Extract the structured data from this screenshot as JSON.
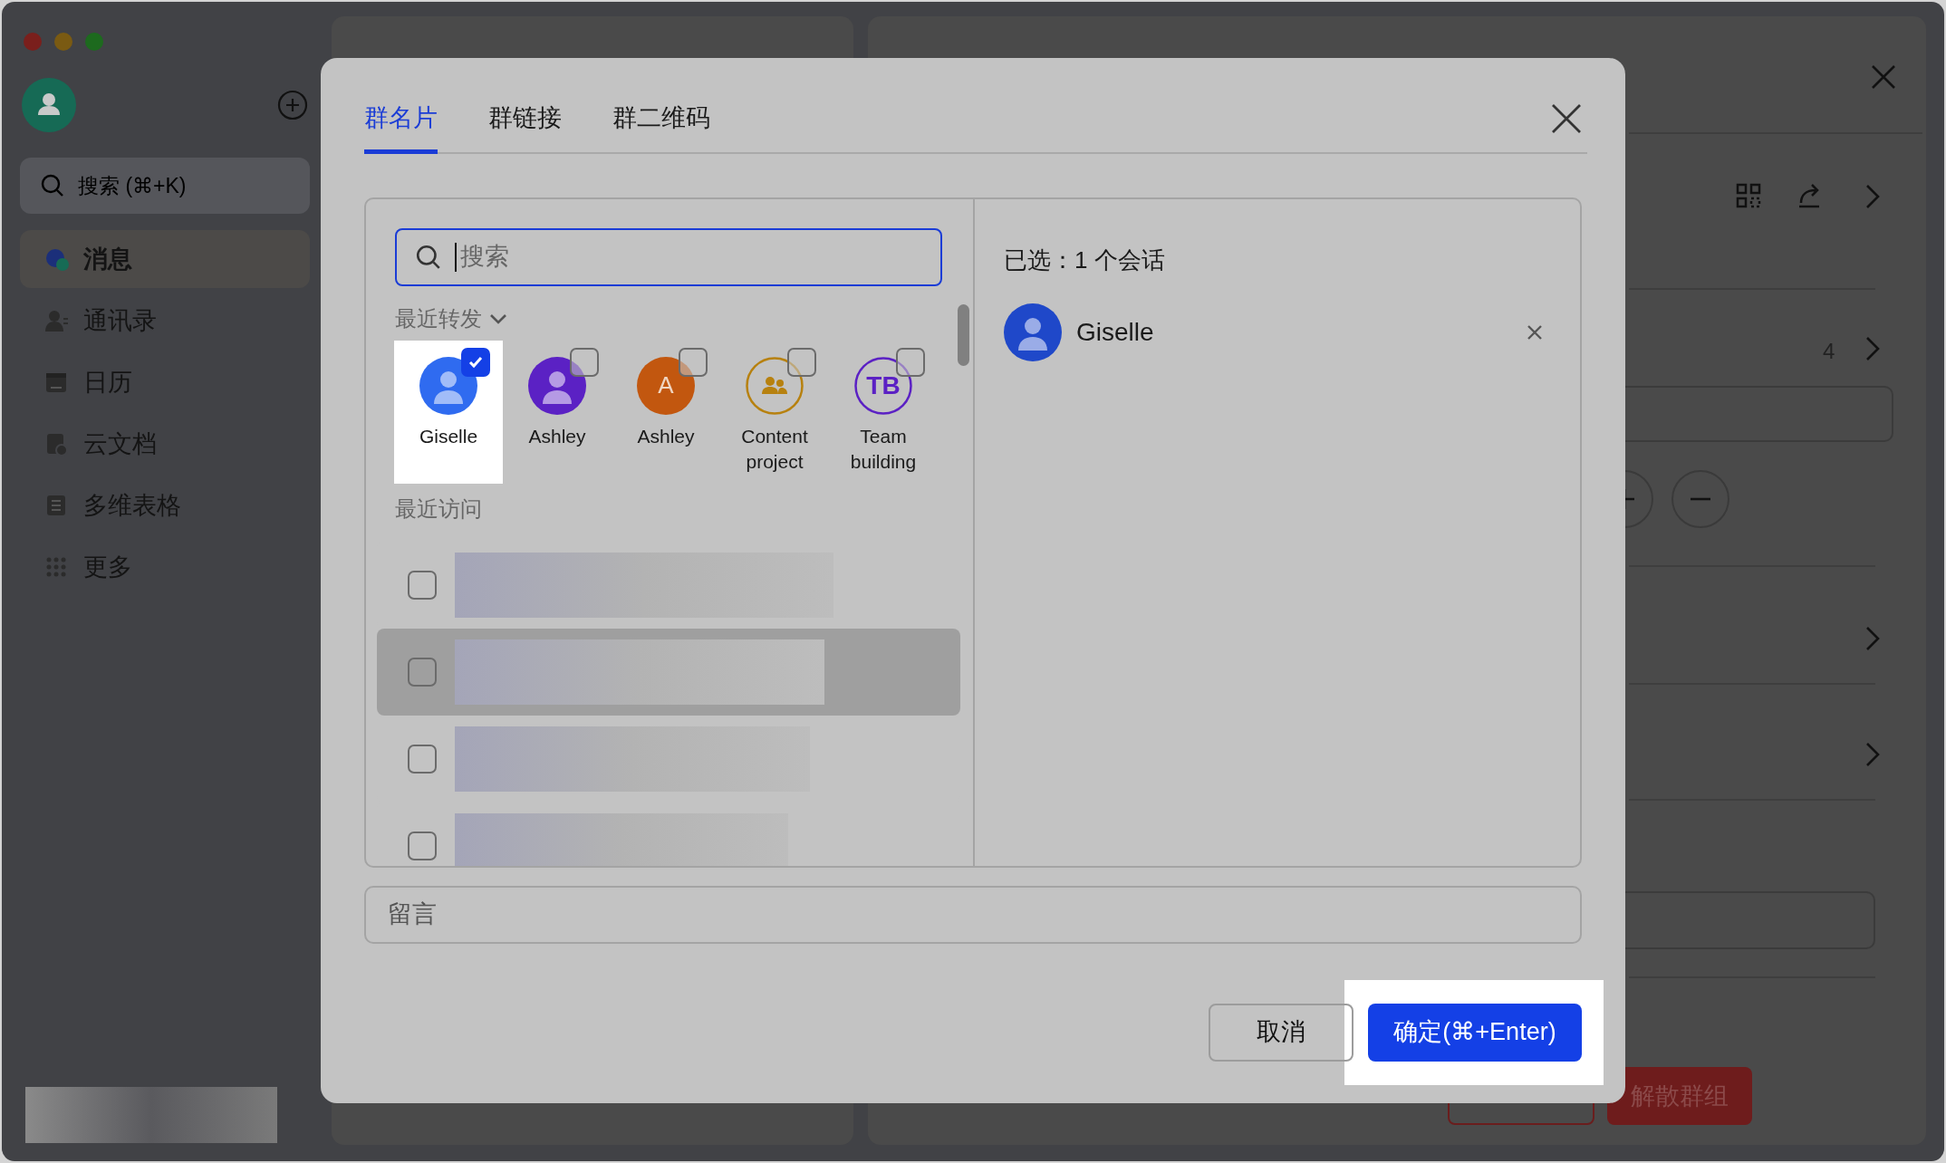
{
  "sidebar": {
    "search": {
      "placeholder": "搜索 (⌘+K)"
    },
    "items": [
      {
        "label": "消息",
        "selected": true
      },
      {
        "label": "通讯录",
        "selected": false
      },
      {
        "label": "日历",
        "selected": false
      },
      {
        "label": "云文档",
        "selected": false
      },
      {
        "label": "多维表格",
        "selected": false
      },
      {
        "label": "更多",
        "selected": false
      }
    ]
  },
  "background_panel": {
    "member_count": "4",
    "dissolve_button": "解散群组"
  },
  "dialog": {
    "tabs": [
      {
        "label": "群名片",
        "selected": true
      },
      {
        "label": "群链接",
        "selected": false
      },
      {
        "label": "群二维码",
        "selected": false
      }
    ],
    "search": {
      "placeholder": "搜索"
    },
    "recent_forward": {
      "title": "最近转发",
      "items": [
        {
          "name": "Giselle",
          "kind": "person",
          "color": "#2f6bf0",
          "checked": true,
          "highlighted": true
        },
        {
          "name": "Ashley",
          "kind": "person",
          "color": "#5b21c4",
          "checked": false,
          "highlighted": false
        },
        {
          "name": "Ashley",
          "kind": "letter",
          "color": "#c2570f",
          "letter": "A",
          "checked": false,
          "highlighted": false
        },
        {
          "name": "Content project",
          "kind": "group",
          "color": "#b7810f",
          "checked": false,
          "highlighted": false
        },
        {
          "name": "Team building",
          "kind": "initials",
          "color": "#5b21c4",
          "letter": "TB",
          "checked": false,
          "highlighted": false
        }
      ]
    },
    "recent_visit": {
      "title": "最近访问",
      "rows": [
        {
          "checked": false,
          "hovered": false
        },
        {
          "checked": false,
          "hovered": true
        },
        {
          "checked": false,
          "hovered": false
        },
        {
          "checked": false,
          "hovered": false
        }
      ]
    },
    "selected_summary": "已选：1 个会话",
    "selected_items": [
      {
        "name": "Giselle"
      }
    ],
    "message": {
      "placeholder": "留言"
    },
    "cancel_button": "取消",
    "confirm_button": "确定(⌘+Enter)",
    "confirm_highlighted": true
  }
}
